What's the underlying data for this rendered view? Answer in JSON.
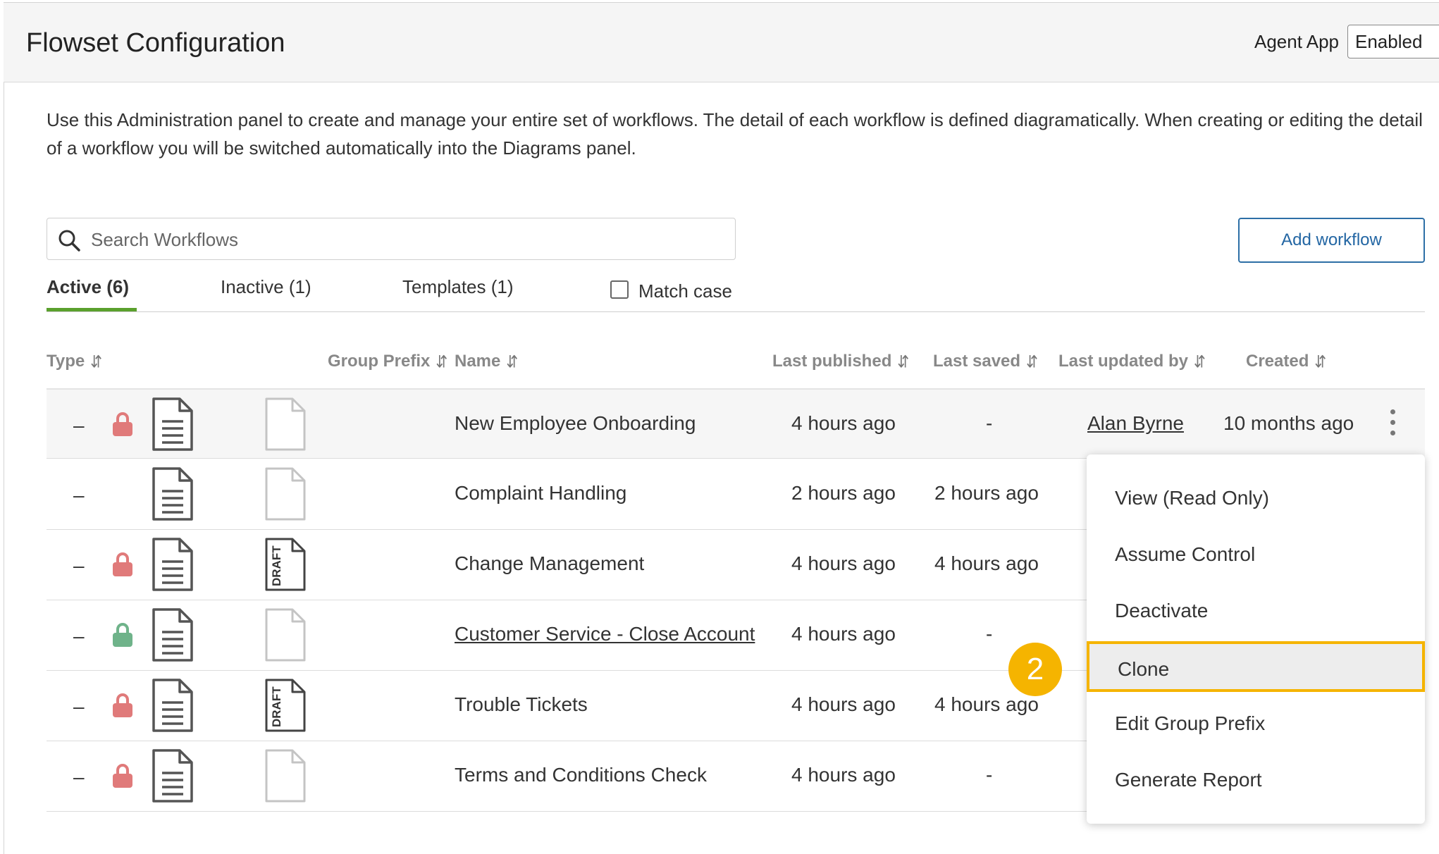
{
  "header": {
    "title": "Flowset Configuration",
    "agent_app_label": "Agent App",
    "agent_app_value": "Enabled"
  },
  "description": "Use this Administration panel to create and manage your entire set of workflows. The detail of each workflow is defined diagramatically. When creating or editing the detail of a workflow you will be switched automatically into the Diagrams panel.",
  "search": {
    "placeholder": "Search Workflows"
  },
  "add_button": "Add workflow",
  "tabs": [
    {
      "label": "Active (6)",
      "active": true
    },
    {
      "label": "Inactive (1)",
      "active": false
    },
    {
      "label": "Templates (1)",
      "active": false
    }
  ],
  "match_case": {
    "label": "Match case",
    "checked": false
  },
  "columns": {
    "type": "Type",
    "group_prefix": "Group Prefix",
    "name": "Name",
    "last_published": "Last published",
    "last_saved": "Last saved",
    "last_updated_by": "Last updated by",
    "created": "Created"
  },
  "rows": [
    {
      "dash": "–",
      "lock": "red",
      "draft": false,
      "name": "New Employee Onboarding",
      "name_link": false,
      "published": "4 hours ago",
      "saved": "-",
      "updated_by": "Alan Byrne",
      "created": "10 months ago"
    },
    {
      "dash": "–",
      "lock": "none",
      "draft": false,
      "name": "Complaint Handling",
      "name_link": false,
      "published": "2 hours ago",
      "saved": "2 hours ago",
      "updated_by": "",
      "created": ""
    },
    {
      "dash": "–",
      "lock": "red",
      "draft": true,
      "name": "Change Management",
      "name_link": false,
      "published": "4 hours ago",
      "saved": "4 hours ago",
      "updated_by": "",
      "created": ""
    },
    {
      "dash": "–",
      "lock": "green",
      "draft": false,
      "name": "Customer Service - Close Account",
      "name_link": true,
      "published": "4 hours ago",
      "saved": "-",
      "updated_by": "",
      "created": ""
    },
    {
      "dash": "–",
      "lock": "red",
      "draft": true,
      "name": "Trouble Tickets",
      "name_link": false,
      "published": "4 hours ago",
      "saved": "4 hours ago",
      "updated_by": "",
      "created": ""
    },
    {
      "dash": "–",
      "lock": "red",
      "draft": false,
      "name": "Terms and Conditions Check",
      "name_link": false,
      "published": "4 hours ago",
      "saved": "-",
      "updated_by": "",
      "created": ""
    }
  ],
  "context_menu": [
    {
      "label": "View (Read Only)",
      "highlighted": false
    },
    {
      "label": "Assume Control",
      "highlighted": false
    },
    {
      "label": "Deactivate",
      "highlighted": false
    },
    {
      "label": "Clone",
      "highlighted": true
    },
    {
      "label": "Edit Group Prefix",
      "highlighted": false
    },
    {
      "label": "Generate Report",
      "highlighted": false
    }
  ],
  "step_badge": "2",
  "draft_text": "DRAFT",
  "colors": {
    "lock_red": "#e07a7a",
    "lock_green": "#6fb38a",
    "accent_green": "#5aa02c",
    "link_blue": "#2366a3",
    "highlight_yellow": "#f5b400"
  },
  "icons": {
    "search": "search-icon",
    "lock": "lock-icon",
    "document": "document-icon",
    "draft": "draft-document-icon",
    "kebab": "more-options-icon",
    "sort": "sort-icon"
  }
}
